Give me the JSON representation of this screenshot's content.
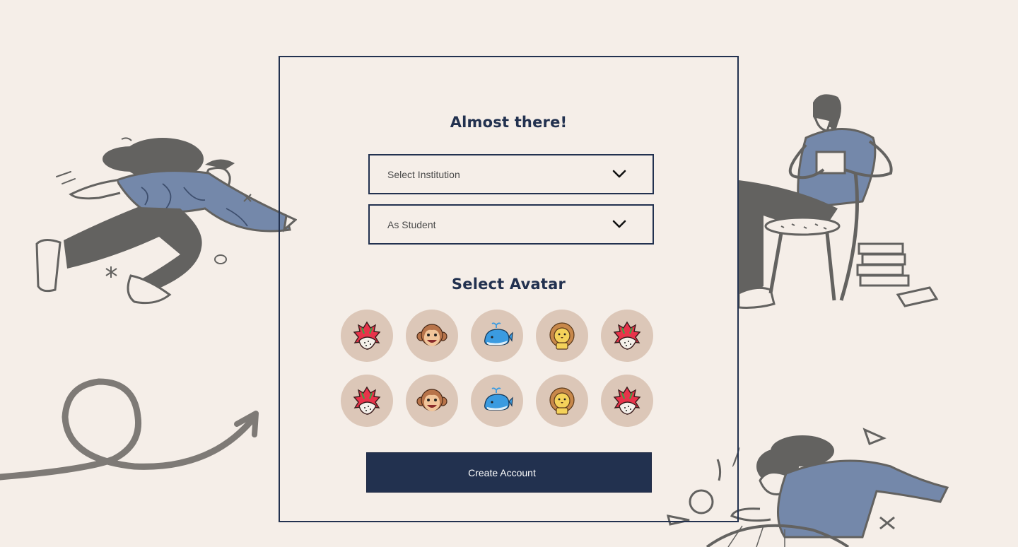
{
  "card": {
    "title": "Almost there!",
    "institution_select": {
      "selected": "Select Institution",
      "icon": "chevron-down-icon"
    },
    "role_select": {
      "selected": "As Student",
      "icon": "chevron-down-icon"
    },
    "avatar_heading": "Select Avatar",
    "avatars": [
      {
        "icon": "dragon-fruit-icon"
      },
      {
        "icon": "monkey-icon"
      },
      {
        "icon": "whale-icon"
      },
      {
        "icon": "lion-icon"
      },
      {
        "icon": "dragon-fruit-icon"
      },
      {
        "icon": "dragon-fruit-icon"
      },
      {
        "icon": "monkey-icon"
      },
      {
        "icon": "whale-icon"
      },
      {
        "icon": "lion-icon"
      },
      {
        "icon": "dragon-fruit-icon"
      }
    ],
    "submit_label": "Create Account"
  },
  "colors": {
    "background": "#f5eee8",
    "navy": "#22314f",
    "avatar_circle": "#dcc7b8",
    "illustration_gray": "#636260",
    "illustration_blue": "#7488aa"
  }
}
